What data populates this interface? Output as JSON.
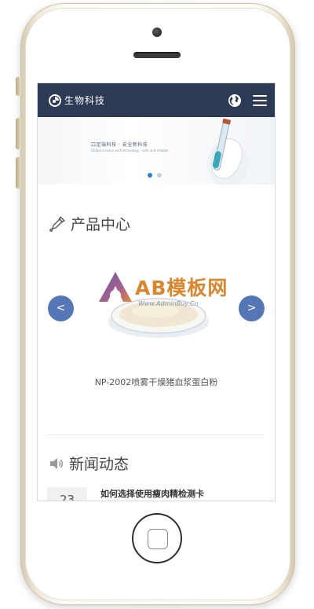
{
  "header": {
    "brand": "生物科技",
    "logo_icon": "swirl-logo-icon",
    "globe_icon": "globe-icon",
    "menu_icon": "hamburger-menu-icon",
    "background": "#2c3a55"
  },
  "banner": {
    "tagline": "口足端科技 · 安全新科技",
    "subline": "Global science and technology · safe and reliable",
    "slides": 2,
    "active_slide": 1,
    "accent": "#2e7ccc"
  },
  "products": {
    "title": "产品中心",
    "icon": "pipette-icon",
    "prev_label": "<",
    "next_label": ">",
    "arrow_color": "#5577b8",
    "item_name": "NP-2002喷雾干燥猪血浆蛋白粉",
    "watermark_text": "AB模板网",
    "watermark_url": "Www.AdminBuy.Cn"
  },
  "news": {
    "title": "新闻动态",
    "icon": "speaker-icon",
    "items": [
      {
        "day": "23",
        "headline": "如何选择使用瘦肉精检测卡"
      }
    ]
  }
}
